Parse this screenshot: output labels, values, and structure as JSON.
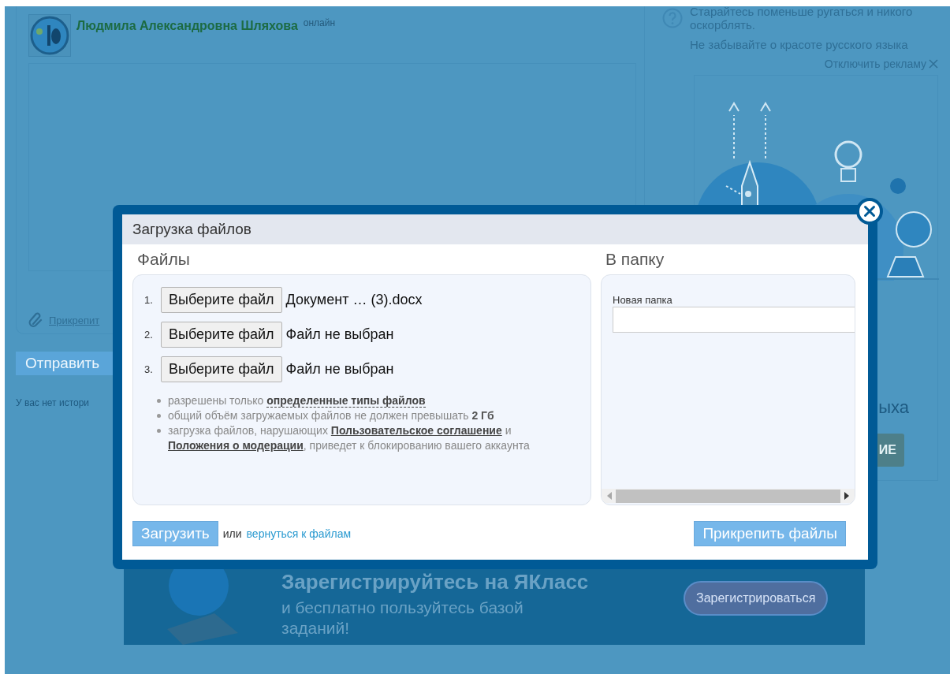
{
  "profile": {
    "name": "Людмила Александровна Шляхова",
    "status": "онлайн"
  },
  "attach_link": "Прикрепит",
  "send_button": "Отправить",
  "history_note": "У вас нет истори",
  "tips": [
    "Старайтесь поменьше ругаться и никого оскорблять.",
    "Не забывайте о красоте русского языка"
  ],
  "ad": {
    "disable_label": "Отключить рекламу",
    "heading_fragment": "ыха",
    "button_fragment": "ИЕ"
  },
  "banner": {
    "heading": "Зарегистрируйтесь на ЯКласс",
    "subtext": "и бесплатно пользуйтесь базой заданий!",
    "button": "Зарегистрироваться"
  },
  "dialog": {
    "title": "Загрузка файлов",
    "files_heading": "Файлы",
    "folder_heading": "В папку",
    "files": [
      {
        "number": "1.",
        "button": "Выберите файл",
        "file_name": "Документ … (3).docx"
      },
      {
        "number": "2.",
        "button": "Выберите файл",
        "file_name": "Файл не выбран"
      },
      {
        "number": "3.",
        "button": "Выберите файл",
        "file_name": "Файл не выбран"
      }
    ],
    "notes": [
      [
        {
          "kind": "text",
          "text": "разрешены только "
        },
        {
          "kind": "dotted_link",
          "text": "определенные типы файлов"
        }
      ],
      [
        {
          "kind": "text",
          "text": "общий объём загружаемых файлов не должен превышать "
        },
        {
          "kind": "bold",
          "text": "2 Гб"
        }
      ],
      [
        {
          "kind": "text",
          "text": "загрузка файлов, нарушающих "
        },
        {
          "kind": "link",
          "text": "Пользовательское соглашение"
        },
        {
          "kind": "text",
          "text": " и "
        },
        {
          "kind": "link",
          "text": "Положения о модерации"
        },
        {
          "kind": "text",
          "text": ", приведет к блокированию вашего аккаунта"
        }
      ]
    ],
    "upload_button": "Загрузить",
    "or_text": "или",
    "back_link": "вернуться к файлам",
    "folder_label": "Новая папка",
    "attach_button": "Прикрепить файлы"
  }
}
